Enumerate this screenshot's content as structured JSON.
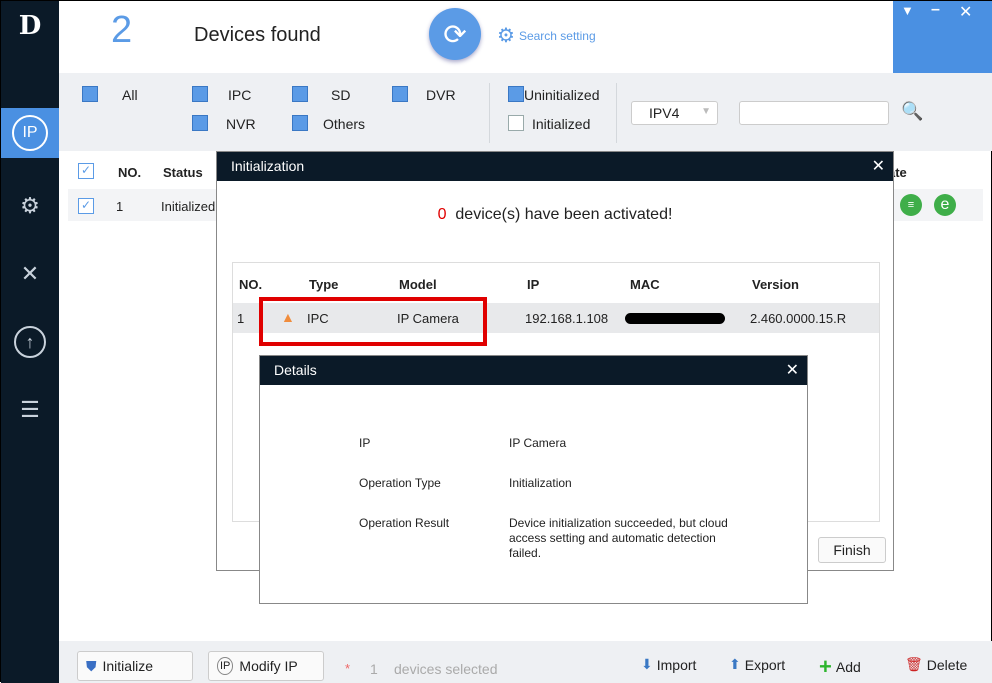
{
  "sidebar": {
    "items": [
      {
        "icon": "logo"
      },
      {
        "icon": "ip-edit-icon",
        "active": true
      },
      {
        "icon": "camera-settings-icon"
      },
      {
        "icon": "tools-icon"
      },
      {
        "icon": "upgrade-icon"
      },
      {
        "icon": "list-icon"
      }
    ]
  },
  "header": {
    "count": "2",
    "title": "Devices found",
    "search_setting": "Search setting"
  },
  "filters": {
    "all": "All",
    "ipc": "IPC",
    "sd": "SD",
    "dvr": "DVR",
    "nvr": "NVR",
    "others": "Others",
    "uninitialized": "Uninitialized",
    "initialized": "Initialized",
    "ip_version": "IPV4",
    "search_value": ""
  },
  "list": {
    "columns": [
      "NO.",
      "Status",
      "ate"
    ],
    "rows": [
      {
        "no": "1",
        "status": "Initialized"
      }
    ]
  },
  "init_dialog": {
    "title": "Initialization",
    "activated_count": "0",
    "activated_text": "device(s) have been activated!",
    "columns": [
      "NO.",
      "Type",
      "Model",
      "IP",
      "MAC",
      "Version"
    ],
    "rows": [
      {
        "no": "1",
        "type": "IPC",
        "model": "IP Camera",
        "ip": "192.168.1.108",
        "mac": "",
        "version": "2.460.0000.15.R"
      }
    ],
    "finish": "Finish"
  },
  "details_dialog": {
    "title": "Details",
    "fields": [
      {
        "label": "IP",
        "value": "IP Camera"
      },
      {
        "label": "Operation Type",
        "value": "Initialization"
      },
      {
        "label": "Operation Result",
        "value": "Device initialization succeeded, but cloud access setting and automatic detection failed."
      }
    ]
  },
  "bottom": {
    "initialize": "Initialize",
    "modify_ip": "Modify IP",
    "selected_count": "1",
    "selected_text": "devices selected",
    "import": "Import",
    "export": "Export",
    "add": "Add",
    "delete": "Delete"
  },
  "colors": {
    "accent": "#4a90e2",
    "dark": "#0b1a28",
    "highlight": "#e00000"
  }
}
